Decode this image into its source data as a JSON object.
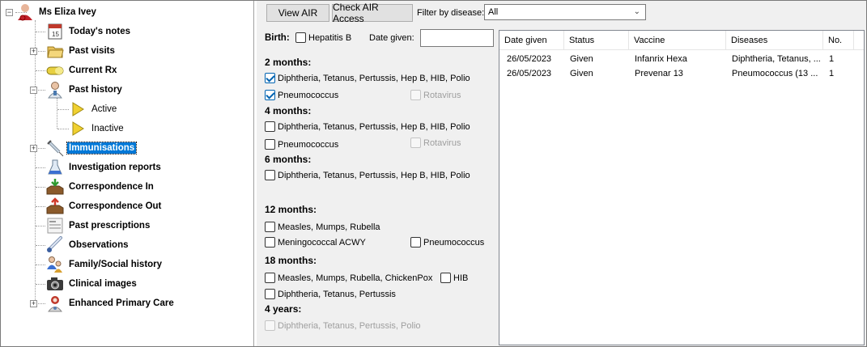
{
  "tree": {
    "patient_name": "Ms Eliza Ivey",
    "items": [
      {
        "label": "Today's notes"
      },
      {
        "label": "Past visits"
      },
      {
        "label": "Current Rx"
      },
      {
        "label": "Past history"
      },
      {
        "label": "Active"
      },
      {
        "label": "Inactive"
      },
      {
        "label": "Immunisations"
      },
      {
        "label": "Investigation reports"
      },
      {
        "label": "Correspondence In"
      },
      {
        "label": "Correspondence Out"
      },
      {
        "label": "Past prescriptions"
      },
      {
        "label": "Observations"
      },
      {
        "label": "Family/Social history"
      },
      {
        "label": "Clinical images"
      },
      {
        "label": "Enhanced Primary Care"
      }
    ],
    "selected": "Immunisations"
  },
  "toolbar": {
    "view_air_label": "View AIR",
    "check_air_label": "Check AIR Access",
    "filter_label": "Filter by disease:",
    "filter_value": "All"
  },
  "schedule": {
    "birth_label": "Birth:",
    "hep_b_label": "Hepatitis B",
    "date_given_label": "Date given:",
    "date_given_value": "",
    "sections": {
      "m2": {
        "title": "2 months:",
        "dtp": "Diphtheria, Tetanus, Pertussis, Hep B, HIB, Polio",
        "pneumo": "Pneumococcus",
        "rota": "Rotavirus"
      },
      "m4": {
        "title": "4 months:",
        "dtp": "Diphtheria, Tetanus, Pertussis, Hep B, HIB, Polio",
        "pneumo": "Pneumococcus",
        "rota": "Rotavirus"
      },
      "m6": {
        "title": "6 months:",
        "dtp": "Diphtheria, Tetanus, Pertussis, Hep B, HIB, Polio"
      },
      "m12": {
        "title": "12 months:",
        "mmr": "Measles, Mumps, Rubella",
        "mening": "Meningococcal ACWY",
        "pneumo": "Pneumococcus"
      },
      "m18": {
        "title": "18 months:",
        "mmrv": "Measles, Mumps, Rubella, ChickenPox",
        "hib": "HIB",
        "dtp": "Diphtheria, Tetanus, Pertussis"
      },
      "y4": {
        "title": "4 years:",
        "dtp": "Diphtheria, Tetanus, Pertussis, Polio"
      }
    }
  },
  "grid": {
    "columns": [
      "Date given",
      "Status",
      "Vaccine",
      "Diseases",
      "No."
    ],
    "rows": [
      [
        "26/05/2023",
        "Given",
        "Infanrix Hexa",
        "Diphtheria, Tetanus, ...",
        "1"
      ],
      [
        "26/05/2023",
        "Given",
        "Prevenar 13",
        "Pneumococcus (13 ...",
        "1"
      ]
    ]
  },
  "colors": {
    "selection": "#0078d7",
    "panel_bg": "#f0f0f0",
    "check": "#0063b1"
  },
  "icons": [
    "patient-icon",
    "calendar-icon",
    "folder-icon",
    "capsule-icon",
    "doctor-icon",
    "triangle-icon",
    "syringe-icon",
    "flask-icon",
    "inbox-icon",
    "outbox-icon",
    "form-icon",
    "thermometer-icon",
    "family-icon",
    "camera-icon",
    "nurse-icon"
  ]
}
